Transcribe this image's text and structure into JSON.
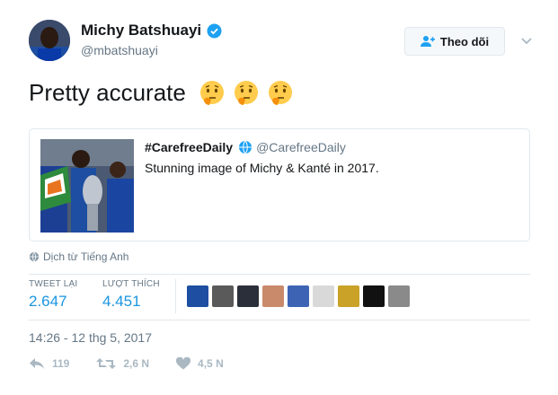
{
  "author": {
    "name": "Michy Batshuayi",
    "handle": "@mbatshuayi",
    "verified_icon": "verified-badge-icon"
  },
  "follow_button": {
    "label": "Theo dõi",
    "icon": "add-user-icon"
  },
  "tweet": {
    "text": "Pretty accurate",
    "emojis": [
      "thinking-face",
      "thinking-face",
      "thinking-face"
    ]
  },
  "quoted": {
    "name": "#CarefreeDaily",
    "handle": "@CarefreeDaily",
    "text": "Stunning image of Michy & Kanté in 2017."
  },
  "translate": {
    "label": "Dịch từ Tiếng Anh"
  },
  "stats": {
    "retweets_label": "TWEET LẠI",
    "retweets_value": "2.647",
    "likes_label": "LƯỢT THÍCH",
    "likes_value": "4.451"
  },
  "likers_count": 9,
  "timestamp": "14:26 - 12 thg 5, 2017",
  "actions": {
    "reply_count": "119",
    "retweet_count": "2,6 N",
    "like_count": "4,5 N"
  },
  "colors": {
    "link": "#1b95e0",
    "muted": "#657786",
    "border": "#e1e8ed"
  }
}
